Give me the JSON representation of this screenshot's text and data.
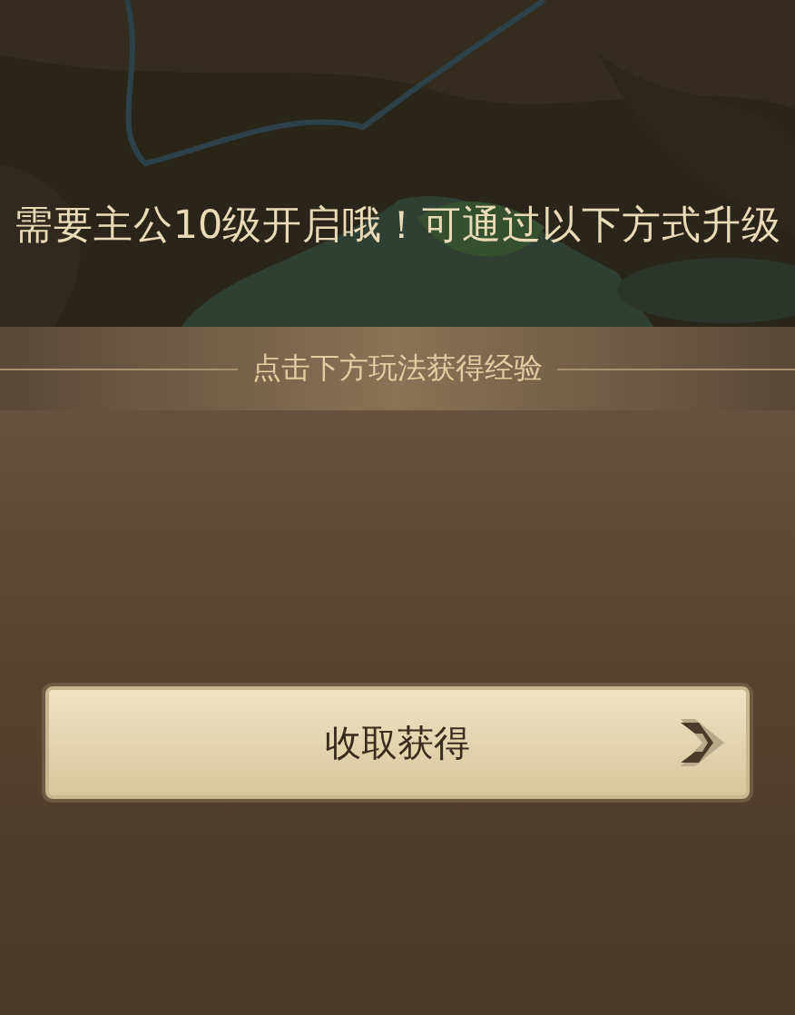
{
  "notice": "需要主公10级开启哦！可通过以下方式升级",
  "panel": {
    "header": "点击下方玩法获得经验",
    "buttons": [
      {
        "label": "收取获得"
      }
    ]
  }
}
